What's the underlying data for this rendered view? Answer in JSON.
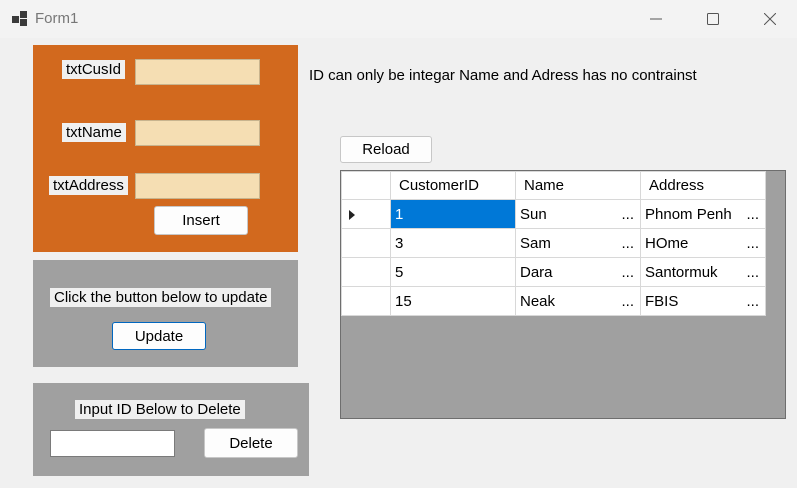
{
  "window": {
    "title": "Form1"
  },
  "insert_panel": {
    "cusid_label": "txtCusId",
    "name_label": "txtName",
    "address_label": "txtAddress",
    "insert_button": "Insert",
    "cusid_value": "",
    "name_value": "",
    "address_value": ""
  },
  "update_panel": {
    "label": "Click the button below to update",
    "update_button": "Update"
  },
  "delete_panel": {
    "label": "Input ID Below to Delete",
    "delete_button": "Delete",
    "id_value": ""
  },
  "info_text": "ID can only be integar Name and Adress has no contrainst",
  "reload_button": "Reload",
  "grid": {
    "columns": [
      "CustomerID",
      "Name",
      "Address"
    ],
    "rows": [
      {
        "id": "1",
        "name": "Sun",
        "address": "Phnom Penh",
        "current": true
      },
      {
        "id": "3",
        "name": "Sam",
        "address": "HOme",
        "current": false
      },
      {
        "id": "5",
        "name": "Dara",
        "address": "Santormuk",
        "current": false
      },
      {
        "id": "15",
        "name": "Neak",
        "address": "FBIS",
        "current": false
      }
    ],
    "ellipsis": "..."
  },
  "colors": {
    "insert_panel": "#d2691e",
    "gray_panel": "#a0a0a0",
    "textbox": "#f5deb3",
    "selection": "#0078d7"
  }
}
